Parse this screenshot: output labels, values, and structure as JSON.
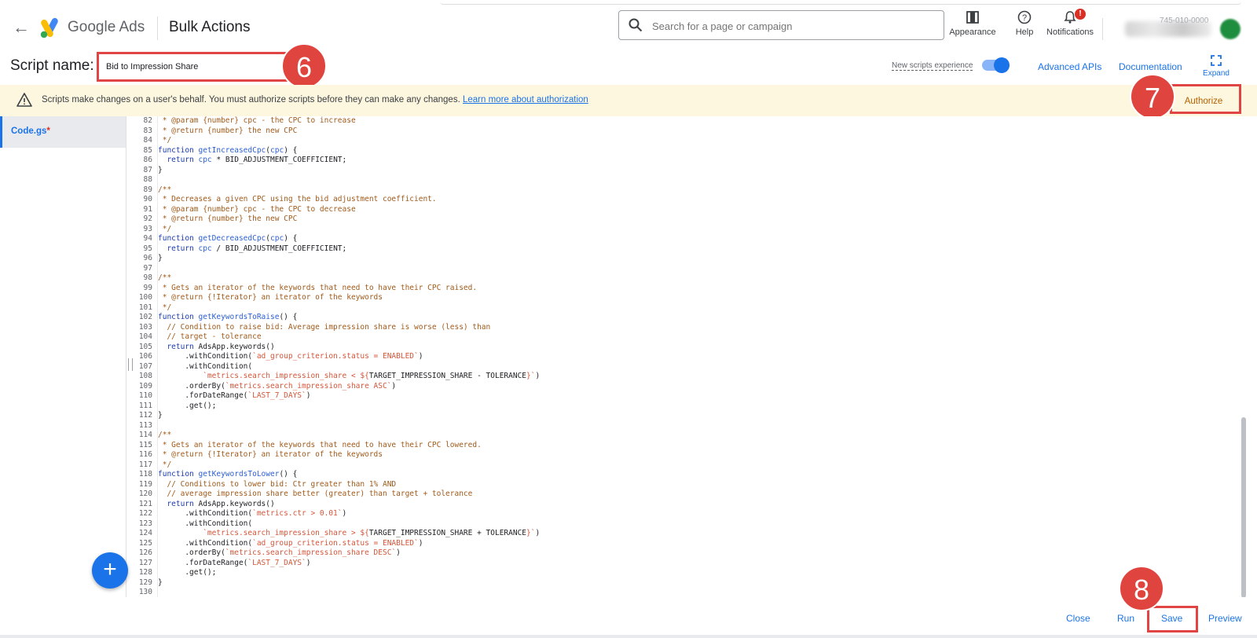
{
  "header": {
    "brand": "Google Ads",
    "page_title": "Bulk Actions",
    "search_placeholder": "Search for a page or campaign",
    "appearance_label": "Appearance",
    "help_label": "Help",
    "notifications_label": "Notifications",
    "notifications_badge": "!",
    "account_number": "745-010-0000"
  },
  "script_bar": {
    "label": "Script name:",
    "script_name": "Bid to Impression Share",
    "new_experience_label": "New scripts experience",
    "new_experience_on": true,
    "advanced_apis": "Advanced APIs",
    "documentation": "Documentation",
    "expand": "Expand"
  },
  "banner": {
    "message": "Scripts make changes on a user's behalf. You must authorize scripts before they can make any changes.",
    "link": "Learn more about authorization",
    "authorize": "Authorize"
  },
  "sidebar": {
    "file_name": "Code.gs",
    "modified_marker": "*"
  },
  "steps": {
    "step6": "6",
    "step7": "7",
    "step8": "8"
  },
  "editor": {
    "lines": [
      {
        "n": "82",
        "t": [
          [
            "c",
            " * @param {number} cpc - the CPC to increase"
          ]
        ]
      },
      {
        "n": "83",
        "t": [
          [
            "c",
            " * @return {number} the new CPC"
          ]
        ]
      },
      {
        "n": "84",
        "t": [
          [
            "c",
            " */"
          ]
        ]
      },
      {
        "n": "85",
        "t": [
          [
            "k",
            "function "
          ],
          [
            "f",
            "getIncreasedCpc"
          ],
          [
            "p",
            "("
          ],
          [
            "f",
            "cpc"
          ],
          [
            "p",
            ") {"
          ]
        ]
      },
      {
        "n": "86",
        "t": [
          [
            "k",
            "  return "
          ],
          [
            "f",
            "cpc"
          ],
          [
            "p",
            " * BID_ADJUSTMENT_COEFFICIENT;"
          ]
        ]
      },
      {
        "n": "87",
        "t": [
          [
            "p",
            "}"
          ]
        ]
      },
      {
        "n": "88",
        "t": [
          [
            "p",
            ""
          ]
        ]
      },
      {
        "n": "89",
        "t": [
          [
            "c",
            "/**"
          ]
        ]
      },
      {
        "n": "90",
        "t": [
          [
            "c",
            " * Decreases a given CPC using the bid adjustment coefficient."
          ]
        ]
      },
      {
        "n": "91",
        "t": [
          [
            "c",
            " * @param {number} cpc - the CPC to decrease"
          ]
        ]
      },
      {
        "n": "92",
        "t": [
          [
            "c",
            " * @return {number} the new CPC"
          ]
        ]
      },
      {
        "n": "93",
        "t": [
          [
            "c",
            " */"
          ]
        ]
      },
      {
        "n": "94",
        "t": [
          [
            "k",
            "function "
          ],
          [
            "f",
            "getDecreasedCpc"
          ],
          [
            "p",
            "("
          ],
          [
            "f",
            "cpc"
          ],
          [
            "p",
            ") {"
          ]
        ]
      },
      {
        "n": "95",
        "t": [
          [
            "k",
            "  return "
          ],
          [
            "f",
            "cpc"
          ],
          [
            "p",
            " / BID_ADJUSTMENT_COEFFICIENT;"
          ]
        ]
      },
      {
        "n": "96",
        "t": [
          [
            "p",
            "}"
          ]
        ]
      },
      {
        "n": "97",
        "t": [
          [
            "p",
            ""
          ]
        ]
      },
      {
        "n": "98",
        "t": [
          [
            "c",
            "/**"
          ]
        ]
      },
      {
        "n": "99",
        "t": [
          [
            "c",
            " * Gets an iterator of the keywords that need to have their CPC raised."
          ]
        ]
      },
      {
        "n": "100",
        "t": [
          [
            "c",
            " * @return {!Iterator} an iterator of the keywords"
          ]
        ]
      },
      {
        "n": "101",
        "t": [
          [
            "c",
            " */"
          ]
        ]
      },
      {
        "n": "102",
        "t": [
          [
            "k",
            "function "
          ],
          [
            "f",
            "getKeywordsToRaise"
          ],
          [
            "p",
            "() {"
          ]
        ]
      },
      {
        "n": "103",
        "t": [
          [
            "c",
            "  // Condition to raise bid: Average impression share is worse (less) than"
          ]
        ]
      },
      {
        "n": "104",
        "t": [
          [
            "c",
            "  // target - tolerance"
          ]
        ]
      },
      {
        "n": "105",
        "t": [
          [
            "k",
            "  return "
          ],
          [
            "p",
            "AdsApp.keywords()"
          ]
        ]
      },
      {
        "n": "106",
        "t": [
          [
            "p",
            "      .withCondition("
          ],
          [
            "s",
            "`ad_group_criterion.status = ENABLED`"
          ],
          [
            "p",
            ")"
          ]
        ]
      },
      {
        "n": "107",
        "t": [
          [
            "p",
            "      .withCondition("
          ]
        ]
      },
      {
        "n": "108",
        "t": [
          [
            "s",
            "          `metrics.search_impression_share < ${"
          ],
          [
            "p",
            "TARGET_IMPRESSION_SHARE - TOLERANCE"
          ],
          [
            "s",
            "}`"
          ],
          [
            "p",
            ")"
          ]
        ]
      },
      {
        "n": "109",
        "t": [
          [
            "p",
            "      .orderBy("
          ],
          [
            "s",
            "`metrics.search_impression_share ASC`"
          ],
          [
            "p",
            ")"
          ]
        ]
      },
      {
        "n": "110",
        "t": [
          [
            "p",
            "      .forDateRange("
          ],
          [
            "s",
            "`LAST_7_DAYS`"
          ],
          [
            "p",
            ")"
          ]
        ]
      },
      {
        "n": "111",
        "t": [
          [
            "p",
            "      .get();"
          ]
        ]
      },
      {
        "n": "112",
        "t": [
          [
            "p",
            "}"
          ]
        ]
      },
      {
        "n": "113",
        "t": [
          [
            "p",
            ""
          ]
        ]
      },
      {
        "n": "114",
        "t": [
          [
            "c",
            "/**"
          ]
        ]
      },
      {
        "n": "115",
        "t": [
          [
            "c",
            " * Gets an iterator of the keywords that need to have their CPC lowered."
          ]
        ]
      },
      {
        "n": "116",
        "t": [
          [
            "c",
            " * @return {!Iterator} an iterator of the keywords"
          ]
        ]
      },
      {
        "n": "117",
        "t": [
          [
            "c",
            " */"
          ]
        ]
      },
      {
        "n": "118",
        "t": [
          [
            "k",
            "function "
          ],
          [
            "f",
            "getKeywordsToLower"
          ],
          [
            "p",
            "() {"
          ]
        ]
      },
      {
        "n": "119",
        "t": [
          [
            "c",
            "  // Conditions to lower bid: Ctr greater than 1% AND"
          ]
        ]
      },
      {
        "n": "120",
        "t": [
          [
            "c",
            "  // average impression share better (greater) than target + tolerance"
          ]
        ]
      },
      {
        "n": "121",
        "t": [
          [
            "k",
            "  return "
          ],
          [
            "p",
            "AdsApp.keywords()"
          ]
        ]
      },
      {
        "n": "122",
        "t": [
          [
            "p",
            "      .withCondition("
          ],
          [
            "s",
            "`metrics.ctr > 0.01`"
          ],
          [
            "p",
            ")"
          ]
        ]
      },
      {
        "n": "123",
        "t": [
          [
            "p",
            "      .withCondition("
          ]
        ]
      },
      {
        "n": "124",
        "t": [
          [
            "s",
            "          `metrics.search_impression_share > ${"
          ],
          [
            "p",
            "TARGET_IMPRESSION_SHARE + TOLERANCE"
          ],
          [
            "s",
            "}`"
          ],
          [
            "p",
            ")"
          ]
        ]
      },
      {
        "n": "125",
        "t": [
          [
            "p",
            "      .withCondition("
          ],
          [
            "s",
            "`ad_group_criterion.status = ENABLED`"
          ],
          [
            "p",
            ")"
          ]
        ]
      },
      {
        "n": "126",
        "t": [
          [
            "p",
            "      .orderBy("
          ],
          [
            "s",
            "`metrics.search_impression_share DESC`"
          ],
          [
            "p",
            ")"
          ]
        ]
      },
      {
        "n": "127",
        "t": [
          [
            "p",
            "      .forDateRange("
          ],
          [
            "s",
            "`LAST_7_DAYS`"
          ],
          [
            "p",
            ")"
          ]
        ]
      },
      {
        "n": "128",
        "t": [
          [
            "p",
            "      .get();"
          ]
        ]
      },
      {
        "n": "129",
        "t": [
          [
            "p",
            "}"
          ]
        ]
      },
      {
        "n": "130",
        "t": [
          [
            "p",
            ""
          ]
        ]
      }
    ]
  },
  "footer": {
    "close": "Close",
    "run": "Run",
    "save": "Save",
    "preview": "Preview"
  },
  "colors": {
    "accent": "#1a73e8",
    "highlight": "#e04444",
    "banner_bg": "#fef7e0",
    "authorize_text": "#b06000"
  }
}
